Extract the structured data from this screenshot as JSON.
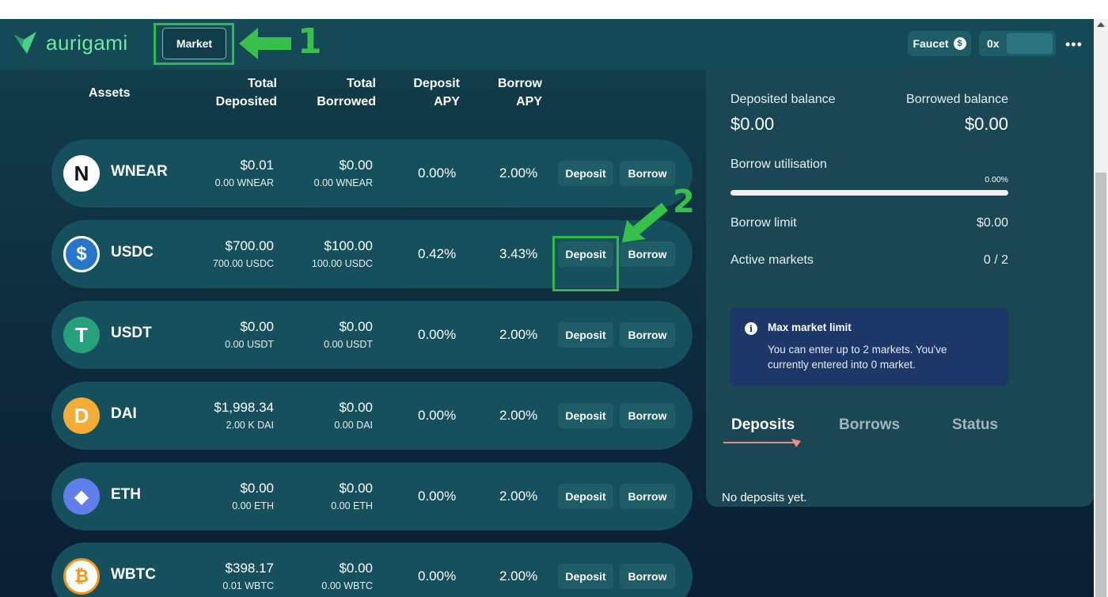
{
  "header": {
    "logo_text": "aurigami",
    "market_label": "Market",
    "annotation_1": "1",
    "faucet_label": "Faucet",
    "faucet_coin": "$",
    "wallet_label": "0x",
    "more_label": "•••"
  },
  "table": {
    "headers": {
      "assets": "Assets",
      "total_deposited_1": "Total",
      "total_deposited_2": "Deposited",
      "total_borrowed_1": "Total",
      "total_borrowed_2": "Borrowed",
      "deposit_apy_1": "Deposit",
      "deposit_apy_2": "APY",
      "borrow_apy_1": "Borrow",
      "borrow_apy_2": "APY"
    },
    "rows": [
      {
        "name": "WNEAR",
        "dep_usd": "$0.01",
        "dep_amt": "0.00  WNEAR",
        "bor_usd": "$0.00",
        "bor_amt": "0.00  WNEAR",
        "dep_apy": "0.00%",
        "bor_apy": "2.00%",
        "deposit": "Deposit",
        "borrow": "Borrow",
        "icon_glyph": "N"
      },
      {
        "name": "USDC",
        "dep_usd": "$700.00",
        "dep_amt": "700.00  USDC",
        "bor_usd": "$100.00",
        "bor_amt": "100.00  USDC",
        "dep_apy": "0.42%",
        "bor_apy": "3.43%",
        "deposit": "Deposit",
        "borrow": "Borrow",
        "icon_glyph": "$"
      },
      {
        "name": "USDT",
        "dep_usd": "$0.00",
        "dep_amt": "0.00  USDT",
        "bor_usd": "$0.00",
        "bor_amt": "0.00  USDT",
        "dep_apy": "0.00%",
        "bor_apy": "2.00%",
        "deposit": "Deposit",
        "borrow": "Borrow",
        "icon_glyph": "T"
      },
      {
        "name": "DAI",
        "dep_usd": "$1,998.34",
        "dep_amt": "2.00 K  DAI",
        "bor_usd": "$0.00",
        "bor_amt": "0.00  DAI",
        "dep_apy": "0.00%",
        "bor_apy": "2.00%",
        "deposit": "Deposit",
        "borrow": "Borrow",
        "icon_glyph": "D"
      },
      {
        "name": "ETH",
        "dep_usd": "$0.00",
        "dep_amt": "0.00  ETH",
        "bor_usd": "$0.00",
        "bor_amt": "0.00  ETH",
        "dep_apy": "0.00%",
        "bor_apy": "2.00%",
        "deposit": "Deposit",
        "borrow": "Borrow",
        "icon_glyph": "◆"
      },
      {
        "name": "WBTC",
        "dep_usd": "$398.17",
        "dep_amt": "0.01  WBTC",
        "bor_usd": "$0.00",
        "bor_amt": "0.00  WBTC",
        "dep_apy": "0.00%",
        "bor_apy": "2.00%",
        "deposit": "Deposit",
        "borrow": "Borrow",
        "icon_glyph": "₿"
      }
    ],
    "annotation_2": "2"
  },
  "panel": {
    "deposited_label": "Deposited balance",
    "deposited_value": "$0.00",
    "borrowed_label": "Borrowed balance",
    "borrowed_value": "$0.00",
    "util_label": "Borrow utilisation",
    "util_pct": "0.00%",
    "limit_label": "Borrow limit",
    "limit_value": "$0.00",
    "active_label": "Active markets",
    "active_value": "0 / 2",
    "info_title": "Max market limit",
    "info_line1": "You can enter up to 2 markets. You've",
    "info_line2": "currently entered into 0 market.",
    "tabs": [
      "Deposits",
      "Borrows",
      "Status"
    ],
    "empty_text": "No deposits yet."
  },
  "colors": {
    "accent_green": "#6fe8a0",
    "annotation_green": "#37c04a",
    "usdc": "#2775ca",
    "usdt": "#26a17b",
    "dai": "#f5ac37",
    "eth": "#627eea",
    "btc": "#f7931a"
  }
}
